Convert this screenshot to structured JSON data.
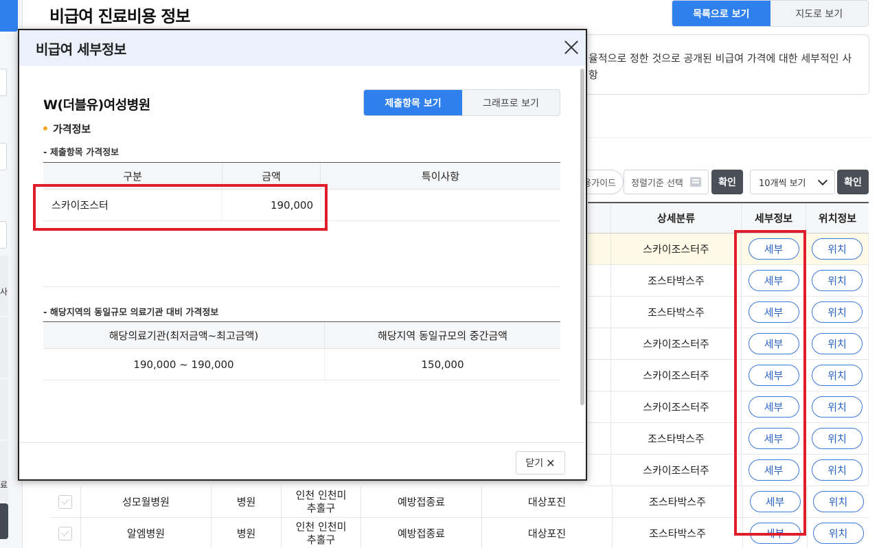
{
  "page": {
    "title": "비급여 진료비용 정보",
    "view_list": "목록으로 보기",
    "view_map": "지도로 보기",
    "notice_text": "율적으로 정한 것으로 공개된 비급여 가격에 대한 세부적인 사",
    "notice_text_2": "항"
  },
  "sidebar": {
    "partial_char_1": "사",
    "partial_char_2": "료"
  },
  "filters": {
    "guide_chip": "용가이드",
    "sort_placeholder": "정렬기준 선택",
    "confirm_1": "확인",
    "page_size": "10개씩 보기",
    "confirm_2": "확인"
  },
  "table": {
    "headers": {
      "detail_category": "상세분류",
      "detail_info": "세부정보",
      "location_info": "위치정보"
    },
    "detail_button": "세부",
    "location_button": "위치",
    "rows": [
      {
        "detail_category": "스카이조스터주"
      },
      {
        "detail_category": "조스타박스주"
      },
      {
        "detail_category": "조스타박스주"
      },
      {
        "detail_category": "스카이조스터주"
      },
      {
        "detail_category": "스카이조스터주"
      },
      {
        "detail_category": "스카이조스터주"
      },
      {
        "detail_category": "조스타박스주"
      },
      {
        "detail_category": "스카이조스터주"
      },
      {
        "hospital": "성모월병원",
        "type": "병원",
        "region_line1": "인천 인천미",
        "region_line2": "추홀구",
        "category": "예방접종료",
        "sub_category": "대상포진",
        "detail_category": "조스타박스주"
      },
      {
        "hospital": "알엠병원",
        "type": "병원",
        "region_line1": "인천 인천미",
        "region_line2": "추홀구",
        "category": "예방접종료",
        "sub_category": "대상포진",
        "detail_category": "조스타박스주"
      }
    ]
  },
  "modal": {
    "title": "비급여 세부정보",
    "hospital_name": "W(더블유)여성병원",
    "tab_items": "제출항목 보기",
    "tab_graph": "그래프로 보기",
    "section_price": "가격정보",
    "submitted_title": "- 제출항목 가격정보",
    "submitted_headers": [
      "구분",
      "금액",
      "특이사항"
    ],
    "submitted_rows": [
      {
        "category": "스카이조스터",
        "amount": "190,000",
        "note": ""
      }
    ],
    "compare_title": "- 해당지역의 동일규모 의료기관 대비 가격정보",
    "compare_headers": [
      "해당의료기관(최저금액~최고금액)",
      "해당지역 동일규모의 중간금액"
    ],
    "compare_values": [
      "190,000 ~ 190,000",
      "150,000"
    ],
    "close_label": "닫기"
  },
  "colors": {
    "accent": "#2f80ed",
    "highlight_frame": "#e01e2b",
    "row_highlight": "#fff9e6"
  }
}
